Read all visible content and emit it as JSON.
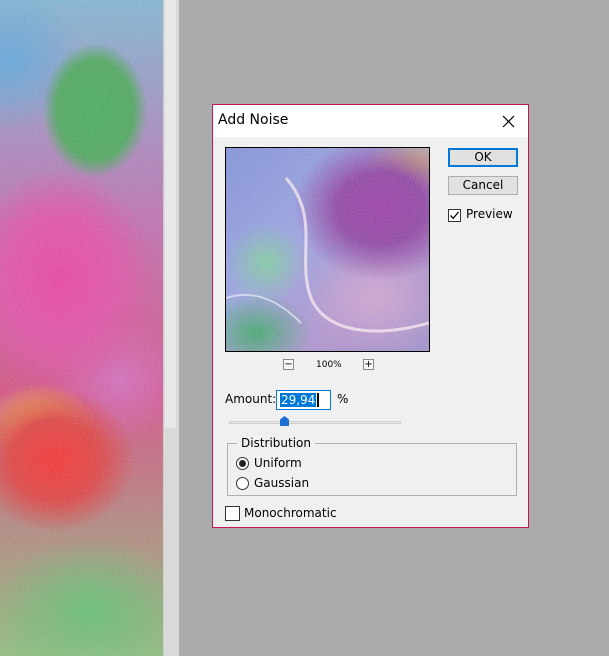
{
  "dialog": {
    "title": "Add Noise",
    "ok_label": "OK",
    "cancel_label": "Cancel",
    "preview_label": "Preview",
    "preview_checked": true,
    "zoom": {
      "minus": "−",
      "plus": "+",
      "level": "100%"
    },
    "amount": {
      "label": "Amount:",
      "value": "29,94",
      "unit": "%"
    },
    "distribution": {
      "legend": "Distribution",
      "options": [
        "Uniform",
        "Gaussian"
      ],
      "selected": "Uniform"
    },
    "monochromatic_label": "Monochromatic",
    "monochromatic_checked": false
  },
  "colors": {
    "dialog_border": "#c2185b",
    "accent": "#0078d7",
    "workspace": "#ababab"
  },
  "icons": {
    "close": "close-icon",
    "checkmark": "checkmark-icon"
  }
}
